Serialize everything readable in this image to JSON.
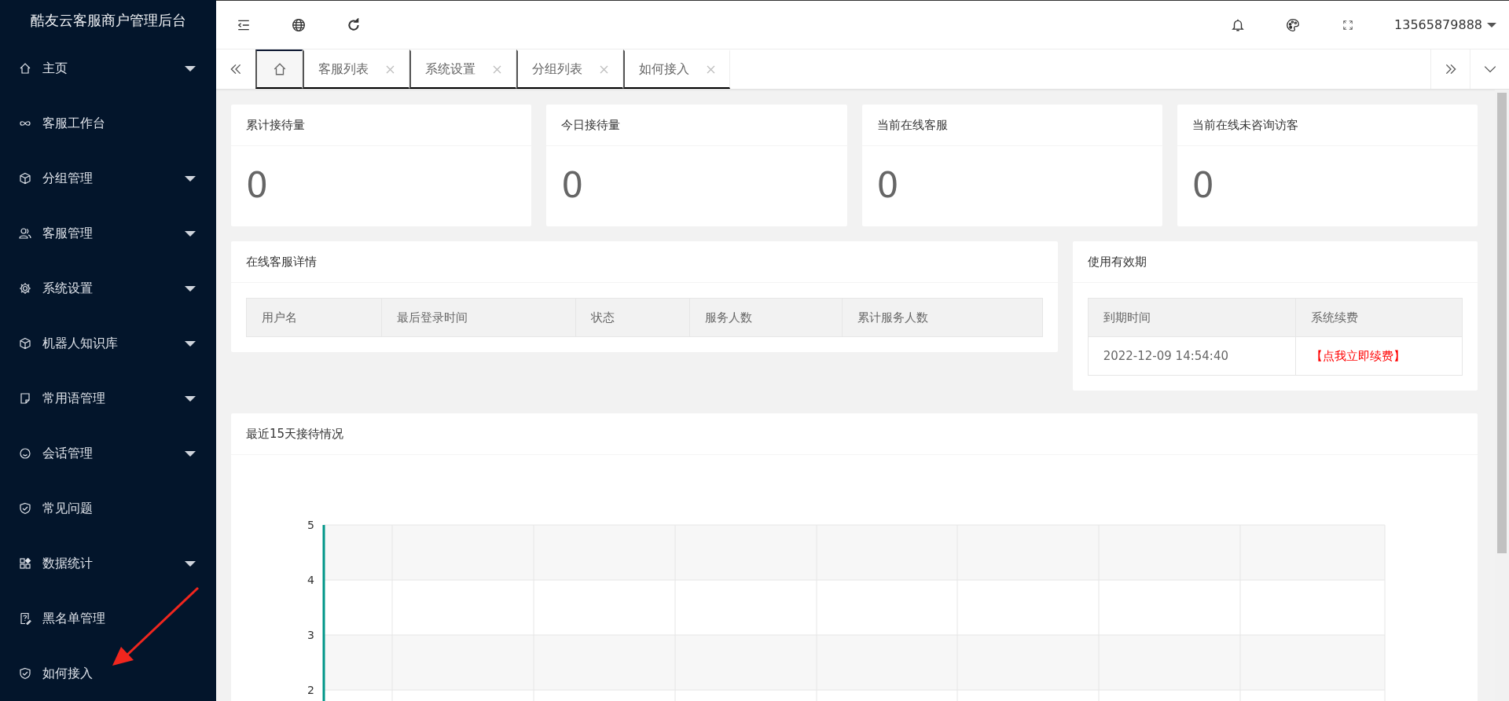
{
  "sidebar": {
    "title": "酷友云客服商户管理后台",
    "items": [
      {
        "label": "主页",
        "expandable": true
      },
      {
        "label": "客服工作台",
        "expandable": false
      },
      {
        "label": "分组管理",
        "expandable": true
      },
      {
        "label": "客服管理",
        "expandable": true
      },
      {
        "label": "系统设置",
        "expandable": true
      },
      {
        "label": "机器人知识库",
        "expandable": true
      },
      {
        "label": "常用语管理",
        "expandable": true
      },
      {
        "label": "会话管理",
        "expandable": true
      },
      {
        "label": "常见问题",
        "expandable": false
      },
      {
        "label": "数据统计",
        "expandable": true
      },
      {
        "label": "黑名单管理",
        "expandable": false
      },
      {
        "label": "如何接入",
        "expandable": false
      }
    ]
  },
  "header": {
    "user": "13565879888"
  },
  "tabs": [
    {
      "kind": "home",
      "selected": true
    },
    {
      "label": "客服列表",
      "kind": "page",
      "selected": false
    },
    {
      "label": "系统设置",
      "kind": "page",
      "selected": false
    },
    {
      "label": "分组列表",
      "kind": "page",
      "selected": false
    },
    {
      "label": "如何接入",
      "kind": "page",
      "selected": false
    }
  ],
  "stats": [
    {
      "title": "累计接待量",
      "value": "0"
    },
    {
      "title": "今日接待量",
      "value": "0"
    },
    {
      "title": "当前在线客服",
      "value": "0"
    },
    {
      "title": "当前在线未咨询访客",
      "value": "0"
    }
  ],
  "online_panel": {
    "title": "在线客服详情",
    "columns": [
      "用户名",
      "最后登录时间",
      "状态",
      "服务人数",
      "累计服务人数"
    ]
  },
  "validity_panel": {
    "title": "使用有效期",
    "columns": [
      "到期时间",
      "系统续费"
    ],
    "rows": [
      {
        "expiry": "2022-12-09 14:54:40",
        "renew_link": "【点我立即续费】"
      }
    ]
  },
  "chart_panel": {
    "title": "最近15天接待情况",
    "y_axis_labels": [
      "5",
      "4",
      "3",
      "2"
    ]
  }
}
